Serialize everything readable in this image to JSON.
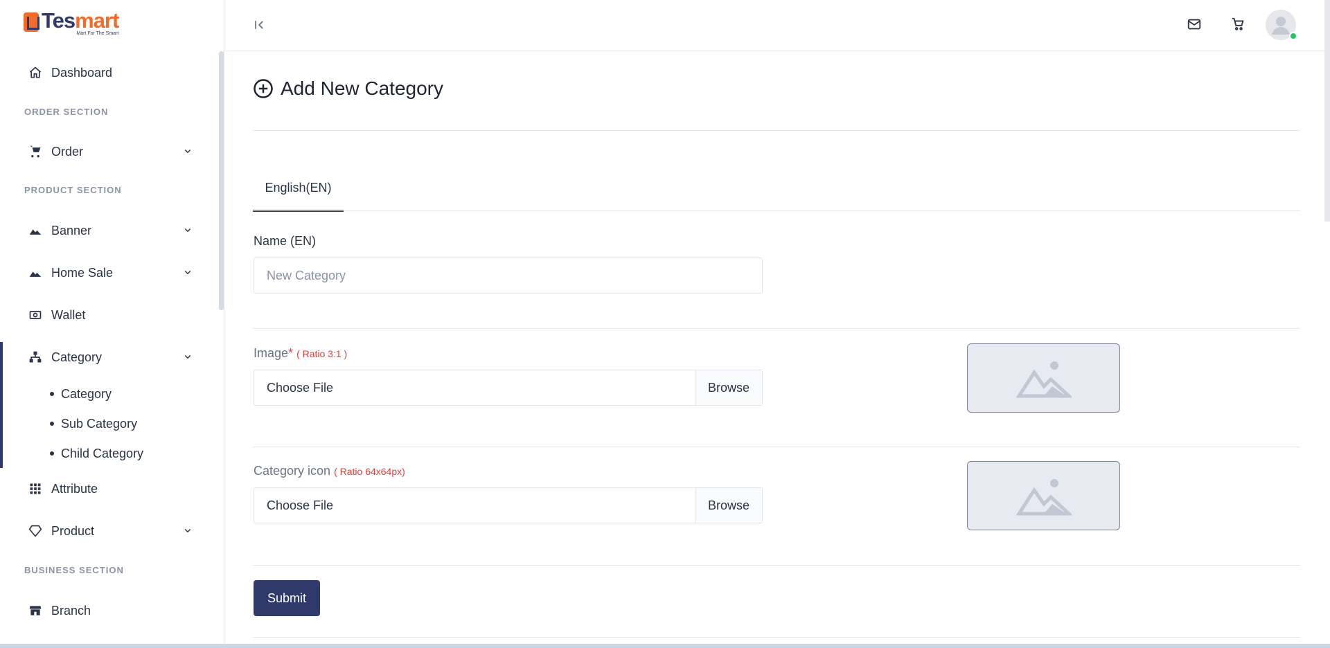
{
  "brand": {
    "name_part1": "Tes",
    "name_part2": "mart",
    "tagline": "Mart For The Smart",
    "accent_color": "#f26b2a",
    "primary_color": "#2f3a6b"
  },
  "sidebar": {
    "items": [
      {
        "label": "Dashboard",
        "icon": "home-icon"
      },
      {
        "section": "ORDER SECTION"
      },
      {
        "label": "Order",
        "icon": "cart-icon",
        "expandable": true
      },
      {
        "section": "PRODUCT SECTION"
      },
      {
        "label": "Banner",
        "icon": "image-icon",
        "expandable": true
      },
      {
        "label": "Home Sale",
        "icon": "image-icon",
        "expandable": true
      },
      {
        "label": "Wallet",
        "icon": "cash-icon"
      },
      {
        "label": "Category",
        "icon": "hierarchy-icon",
        "expandable": true,
        "active": true
      },
      {
        "label": "Attribute",
        "icon": "grid-icon"
      },
      {
        "label": "Product",
        "icon": "diamond-icon",
        "expandable": true
      },
      {
        "section": "BUSINESS SECTION"
      },
      {
        "label": "Branch",
        "icon": "store-icon"
      }
    ],
    "category_sub_items": [
      "Category",
      "Sub Category",
      "Child Category"
    ]
  },
  "topbar": {
    "icons": [
      "collapse-icon",
      "mail-icon",
      "cart-icon",
      "avatar"
    ]
  },
  "page": {
    "title": "Add New Category",
    "tabs": [
      {
        "label": "English(EN)",
        "active": true
      }
    ],
    "name_field": {
      "label": "Name (EN)",
      "placeholder": "New Category",
      "value": ""
    },
    "image_field": {
      "label": "Image",
      "required_mark": "*",
      "hint": "( Ratio 3:1 )",
      "file_label": "Choose File",
      "browse_label": "Browse"
    },
    "icon_field": {
      "label": "Category icon",
      "hint": "( Ratio 64x64px)",
      "file_label": "Choose File",
      "browse_label": "Browse"
    },
    "submit_label": "Submit"
  }
}
